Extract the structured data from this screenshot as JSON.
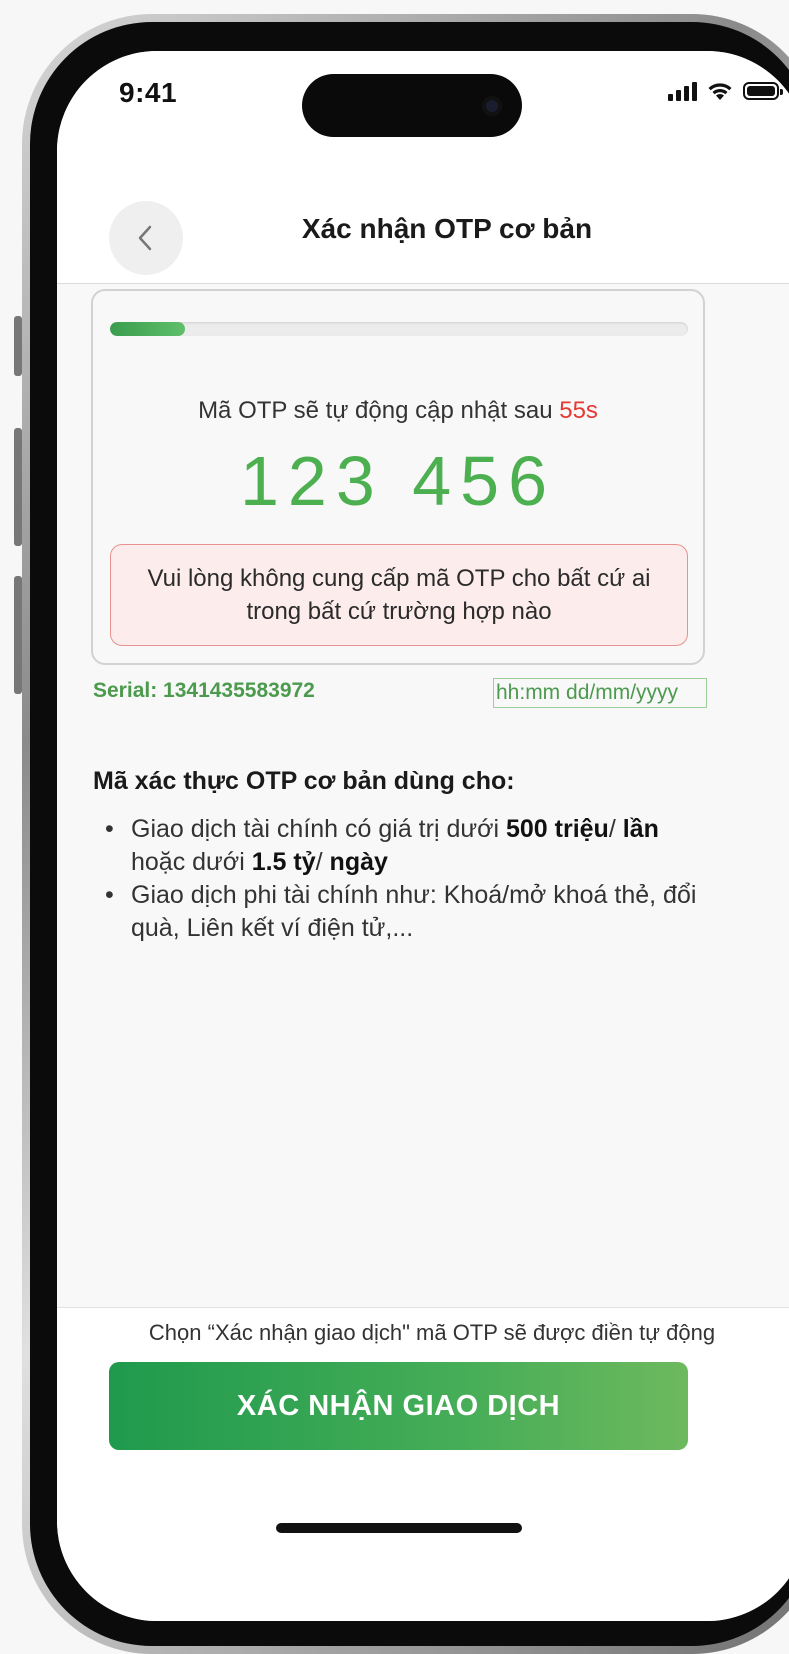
{
  "status_bar": {
    "time": "9:41"
  },
  "header": {
    "title": "Xác nhận OTP cơ bản"
  },
  "otp": {
    "progress_fraction": 0.13,
    "caption_prefix": "Mã OTP sẽ tự động cập nhật sau ",
    "countdown": "55s",
    "code": "123 456",
    "warning": "Vui lòng không cung cấp mã OTP cho bất cứ ai trong bất cứ trường hợp nào"
  },
  "meta": {
    "serial": "Serial: 1341435583972",
    "datetime": "hh:mm dd/mm/yyyy"
  },
  "usage": {
    "title": "Mã xác thực OTP cơ bản dùng cho:",
    "item1": {
      "t1": "Giao dịch tài chính có giá trị dưới ",
      "b1": "500 triệu",
      "t2": "/ ",
      "b2": "lần",
      "t3": " hoặc dưới ",
      "b3": "1.5 tỷ",
      "t4": "/ ",
      "b4": "ngày"
    },
    "item2": "Giao dịch phi tài chính như: Khoá/mở khoá thẻ, đổi quà, Liên kết ví điện tử,..."
  },
  "footer": {
    "note": "Chọn “Xác nhận giao dịch\" mã OTP sẽ được điền tự động",
    "confirm_label": "XÁC NHẬN GIAO DỊCH"
  },
  "colors": {
    "accent_green": "#4caf50",
    "countdown_red": "#e53935",
    "warning_bg": "#fdecec"
  }
}
